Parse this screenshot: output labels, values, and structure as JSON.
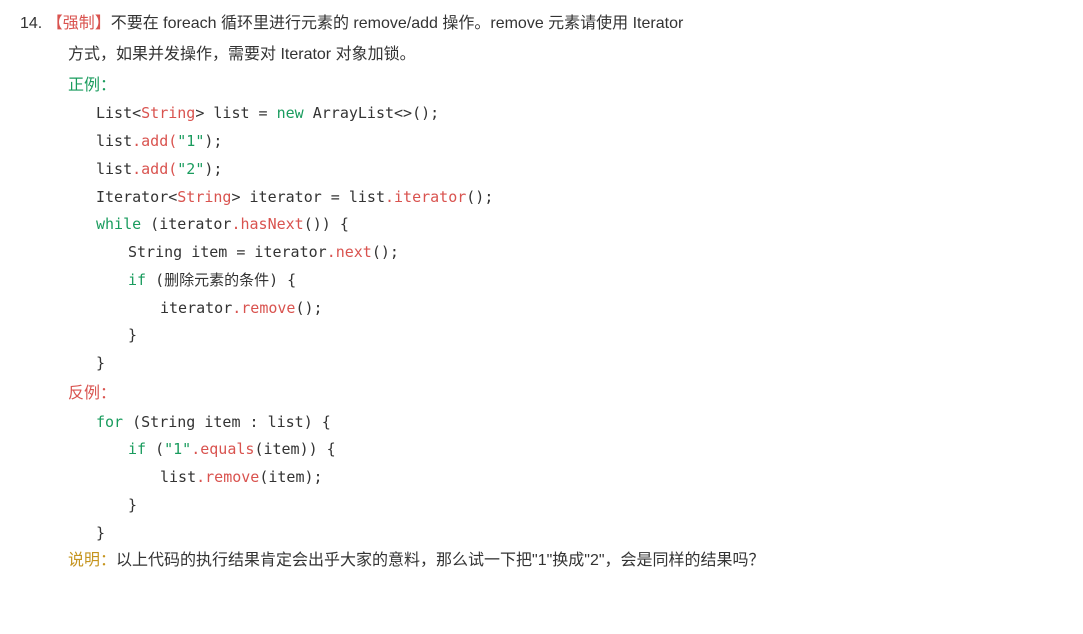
{
  "item": {
    "number": "14.",
    "tag": "【强制】",
    "rule_line1": "不要在 foreach 循环里进行元素的 remove/add 操作。remove 元素请使用 Iterator",
    "rule_line2": "方式，如果并发操作，需要对 Iterator 对象加锁。"
  },
  "positive": {
    "label": "正例："
  },
  "code1": {
    "l1_a": "List",
    "l1_b": "<",
    "l1_c": "String",
    "l1_d": "> list = ",
    "l1_e": "new",
    "l1_f": " ArrayList<>();",
    "l2_a": "list",
    "l2_b": ".add(",
    "l2_c": "\"1\"",
    "l2_d": ");",
    "l3_a": "list",
    "l3_b": ".add(",
    "l3_c": "\"2\"",
    "l3_d": ");",
    "l4_a": "Iterator",
    "l4_b": "<",
    "l4_c": "String",
    "l4_d": "> iterator = list",
    "l4_e": ".iterator",
    "l4_f": "();",
    "l5_a": "while",
    "l5_b": " (iterator",
    "l5_c": ".hasNext",
    "l5_d": "()) {",
    "l6_a": "String item = iterator",
    "l6_b": ".next",
    "l6_c": "();",
    "l7_a": "if",
    "l7_b": " (删除元素的条件) {",
    "l8_a": "iterator",
    "l8_b": ".remove",
    "l8_c": "();",
    "l9": "}",
    "l10": "}"
  },
  "negative": {
    "label": "反例："
  },
  "code2": {
    "l1_a": "for",
    "l1_b": " (String item : list) {",
    "l2_a": "if",
    "l2_b": " (",
    "l2_c": "\"1\"",
    "l2_d": ".equals",
    "l2_e": "(item)) {",
    "l3_a": "list",
    "l3_b": ".remove",
    "l3_c": "(item);",
    "l4": "}",
    "l5": "}"
  },
  "explanation": {
    "label": "说明：",
    "text": "以上代码的执行结果肯定会出乎大家的意料，那么试一下把\"1\"换成\"2\"，会是同样的结果吗？"
  }
}
